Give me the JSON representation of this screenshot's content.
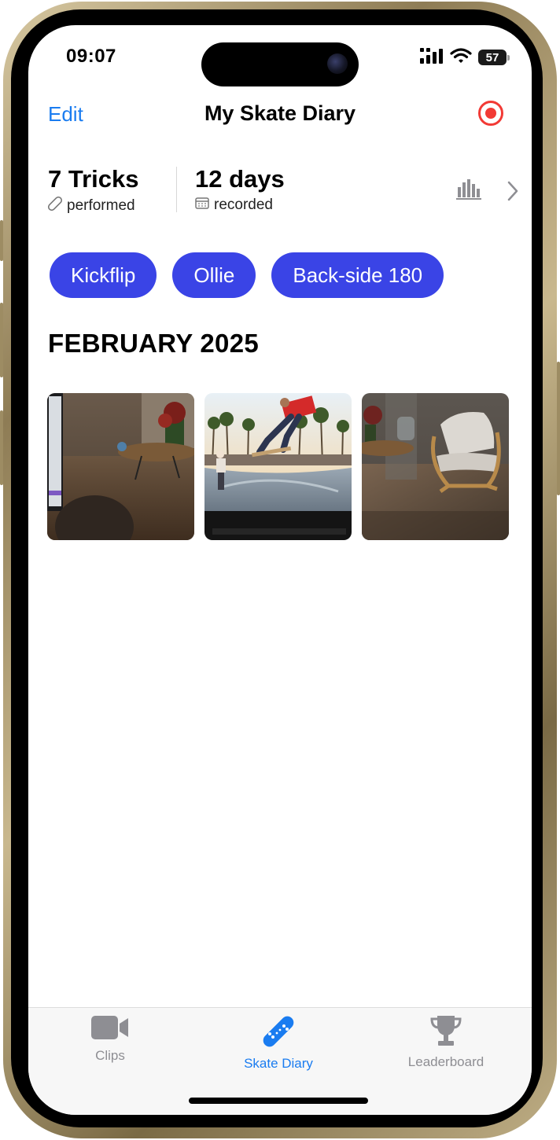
{
  "status_bar": {
    "time": "09:07",
    "battery": "57"
  },
  "nav": {
    "edit_label": "Edit",
    "title": "My Skate Diary"
  },
  "stats": [
    {
      "value": "7 Tricks",
      "sub": "performed",
      "icon": "skateboard-small-icon"
    },
    {
      "value": "12 days",
      "sub": "recorded",
      "icon": "calendar-icon"
    }
  ],
  "chips": [
    "Kickflip",
    "Ollie",
    "Back-side 180"
  ],
  "section": {
    "title": "FEBRUARY 2025"
  },
  "thumbnails": [
    {
      "name": "video-thumbnail-room-laptop"
    },
    {
      "name": "video-thumbnail-skatepark"
    },
    {
      "name": "video-thumbnail-room-chair"
    }
  ],
  "tabbar": {
    "tabs": [
      {
        "label": "Clips",
        "icon": "video-camera-icon",
        "active": false
      },
      {
        "label": "Skate Diary",
        "icon": "skateboard-icon",
        "active": true
      },
      {
        "label": "Leaderboard",
        "icon": "trophy-icon",
        "active": false
      }
    ]
  },
  "colors": {
    "accent": "#1a7cf0",
    "chip": "#3a44e6",
    "record": "#f23a35",
    "tab_inactive": "#8e8e93"
  }
}
